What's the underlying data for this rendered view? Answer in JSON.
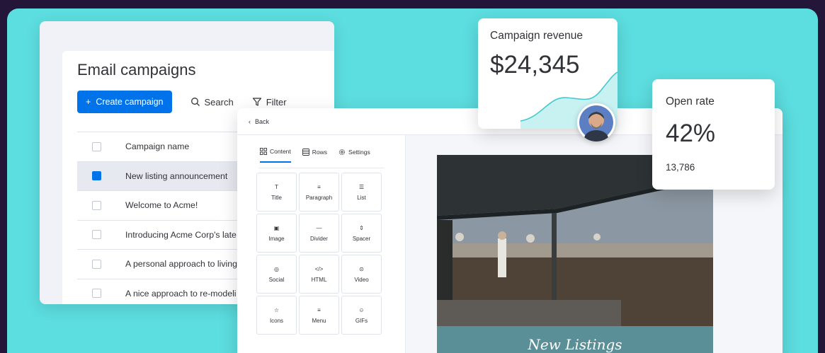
{
  "campaigns": {
    "title": "Email campaigns",
    "create_label": "Create campaign",
    "create_icon": "+",
    "search_label": "Search",
    "filter_label": "Filter",
    "column_header": "Campaign name",
    "rows": [
      {
        "name": "New listing announcement",
        "selected": true
      },
      {
        "name": "Welcome to Acme!",
        "selected": false
      },
      {
        "name": "Introducing Acme Corp's late",
        "selected": false
      },
      {
        "name": "A personal approach to living",
        "selected": false
      },
      {
        "name": "A nice approach to re-modeli",
        "selected": false
      }
    ],
    "accent_color": "#0073ea"
  },
  "editor": {
    "back_label": "Back",
    "tabs": [
      {
        "label": "Content",
        "icon": "grid-icon",
        "active": true
      },
      {
        "label": "Rows",
        "icon": "rows-icon",
        "active": false
      },
      {
        "label": "Settings",
        "icon": "gear-icon",
        "active": false
      }
    ],
    "blocks": [
      {
        "label": "Title",
        "icon": "title-icon",
        "glyph": "T"
      },
      {
        "label": "Paragraph",
        "icon": "paragraph-icon",
        "glyph": "≡"
      },
      {
        "label": "List",
        "icon": "list-icon",
        "glyph": "☰"
      },
      {
        "label": "Image",
        "icon": "image-icon",
        "glyph": "▣"
      },
      {
        "label": "Divider",
        "icon": "divider-icon",
        "glyph": "—"
      },
      {
        "label": "Spacer",
        "icon": "spacer-icon",
        "glyph": "⇕"
      },
      {
        "label": "Social",
        "icon": "social-icon",
        "glyph": "◎"
      },
      {
        "label": "HTML",
        "icon": "html-icon",
        "glyph": "</>"
      },
      {
        "label": "Video",
        "icon": "video-icon",
        "glyph": "⊙"
      },
      {
        "label": "Icons",
        "icon": "star-icon",
        "glyph": "☆"
      },
      {
        "label": "Menu",
        "icon": "menu-icon",
        "glyph": "≡"
      },
      {
        "label": "GIFs",
        "icon": "smiley-icon",
        "glyph": "☺"
      }
    ],
    "preview_caption": "New Listings"
  },
  "revenue": {
    "label": "Campaign revenue",
    "value": "$24,345"
  },
  "open_rate": {
    "label": "Open rate",
    "value": "42%",
    "count": "13,786"
  },
  "colors": {
    "page_bg": "#231638",
    "stage_bg": "#5cdddf",
    "accent": "#0073ea",
    "caption_bg": "#5a8f97"
  }
}
